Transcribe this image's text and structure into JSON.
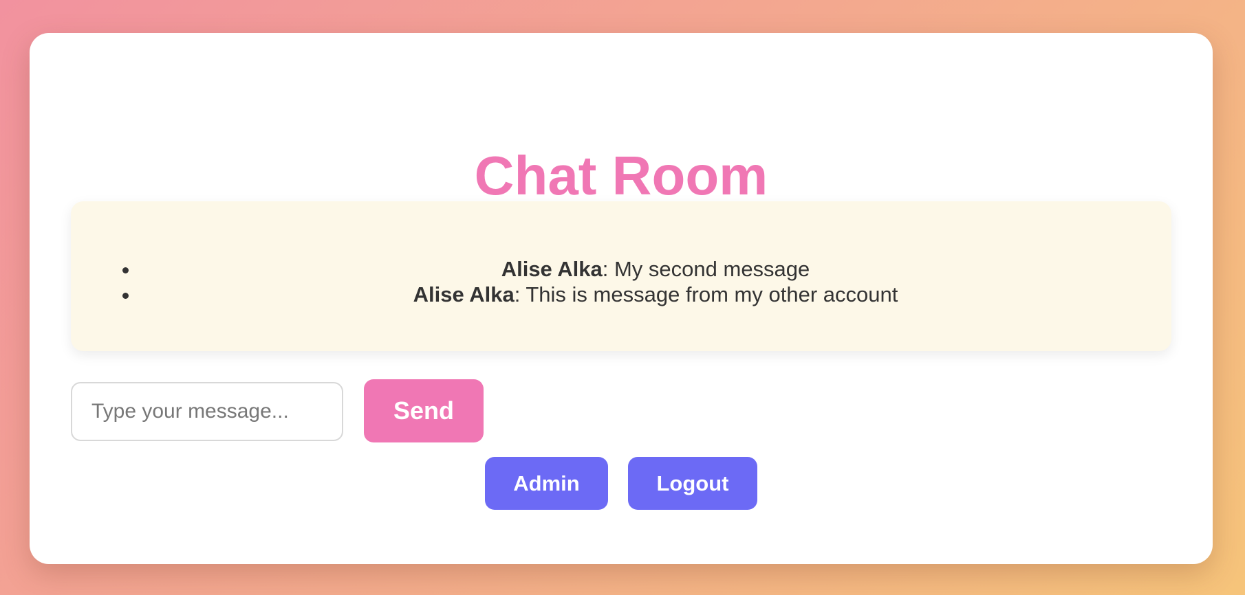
{
  "page": {
    "title": "Chat Room"
  },
  "messages": [
    {
      "author": "Alise Alka",
      "separator": ": ",
      "text": "My second message"
    },
    {
      "author": "Alise Alka",
      "separator": ": ",
      "text": "This is message from my other account"
    }
  ],
  "composer": {
    "placeholder": "Type your message...",
    "value": "",
    "send_label": "Send"
  },
  "nav": {
    "admin_label": "Admin",
    "logout_label": "Logout"
  },
  "colors": {
    "accent_pink": "#f077b4",
    "accent_purple": "#6c6af5",
    "message_panel_bg": "#fdf8e8"
  }
}
